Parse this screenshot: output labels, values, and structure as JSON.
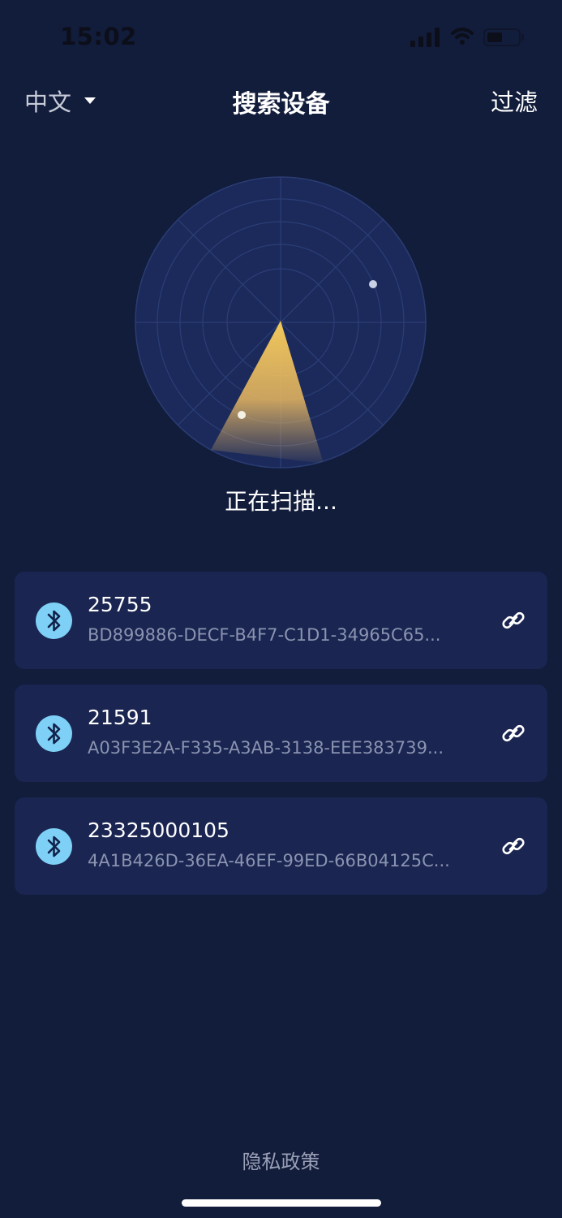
{
  "status_bar": {
    "time": "15:02"
  },
  "nav": {
    "language": "中文",
    "title": "搜索设备",
    "filter": "过滤"
  },
  "scan": {
    "status": "正在扫描..."
  },
  "devices": [
    {
      "name": "25755",
      "uuid": "BD899886-DECF-B4F7-C1D1-34965C65...",
      "icon": "bluetooth-icon",
      "action_icon": "link-icon"
    },
    {
      "name": "21591",
      "uuid": "A03F3E2A-F335-A3AB-3138-EEE383739...",
      "icon": "bluetooth-icon",
      "action_icon": "link-icon"
    },
    {
      "name": "23325000105",
      "uuid": "4A1B426D-36EA-46EF-99ED-66B04125C...",
      "icon": "bluetooth-icon",
      "action_icon": "link-icon"
    }
  ],
  "footer": {
    "privacy": "隐私政策"
  },
  "colors": {
    "background": "#121c3b",
    "card": "#1a2551",
    "accent_bluetooth": "#7ed0f6",
    "radar_sweep": "#f2c85b"
  }
}
